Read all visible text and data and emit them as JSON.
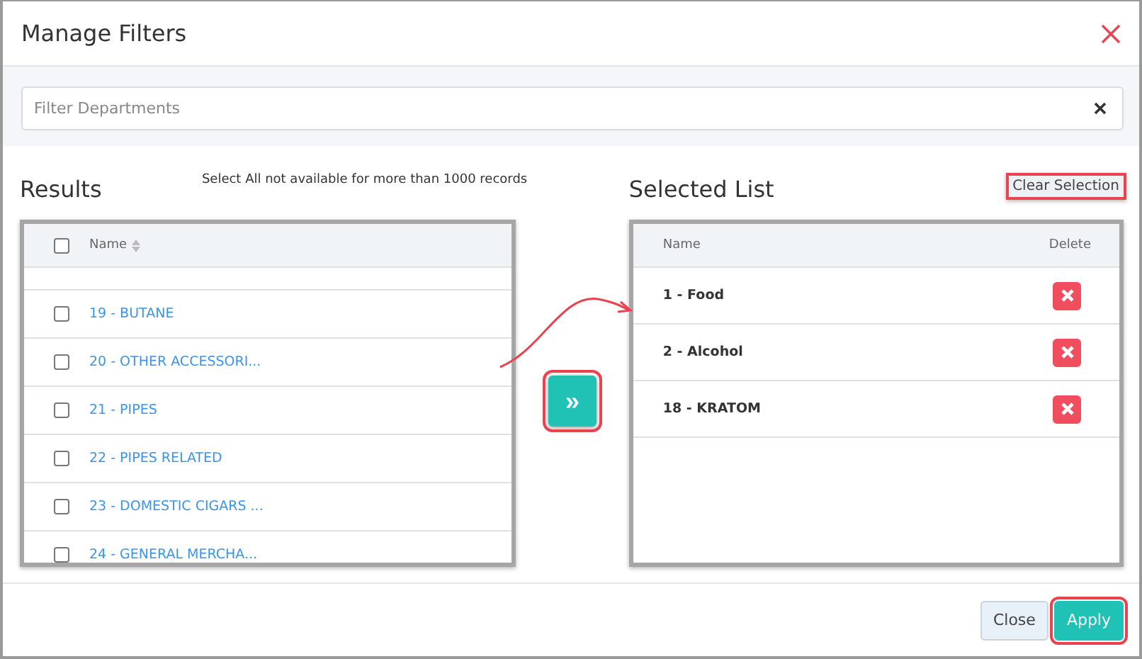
{
  "dialog": {
    "title": "Manage Filters"
  },
  "search": {
    "placeholder": "Filter Departments"
  },
  "results": {
    "title": "Results",
    "note": "Select All not available for more than 1000 records",
    "select_all_checked": false,
    "column": "Name",
    "rows": [
      {
        "label": "19 - BUTANE",
        "checked": false
      },
      {
        "label": "20 - OTHER ACCESSORI...",
        "checked": false
      },
      {
        "label": "21 - PIPES",
        "checked": false
      },
      {
        "label": "22 - PIPES RELATED",
        "checked": false
      },
      {
        "label": "23 - DOMESTIC CIGARS ...",
        "checked": false
      },
      {
        "label": "24 - GENERAL MERCHA...",
        "checked": false
      }
    ],
    "highlighted": false
  },
  "move_button": {
    "label": "»",
    "highlighted": true
  },
  "selected_list": {
    "title": "Selected List",
    "clear_button": {
      "label": "Clear Selection",
      "highlighted": true
    },
    "columns": [
      "Name",
      "Delete"
    ],
    "rows": [
      {
        "label": "1 - Food"
      },
      {
        "label": "2 - Alcohol"
      },
      {
        "label": "18 - KRATOM"
      }
    ]
  },
  "footer": {
    "buttons": [
      {
        "label": "Close",
        "kind": "secondary",
        "highlighted": false
      },
      {
        "label": "Apply",
        "kind": "primary",
        "highlighted": true
      }
    ]
  }
}
